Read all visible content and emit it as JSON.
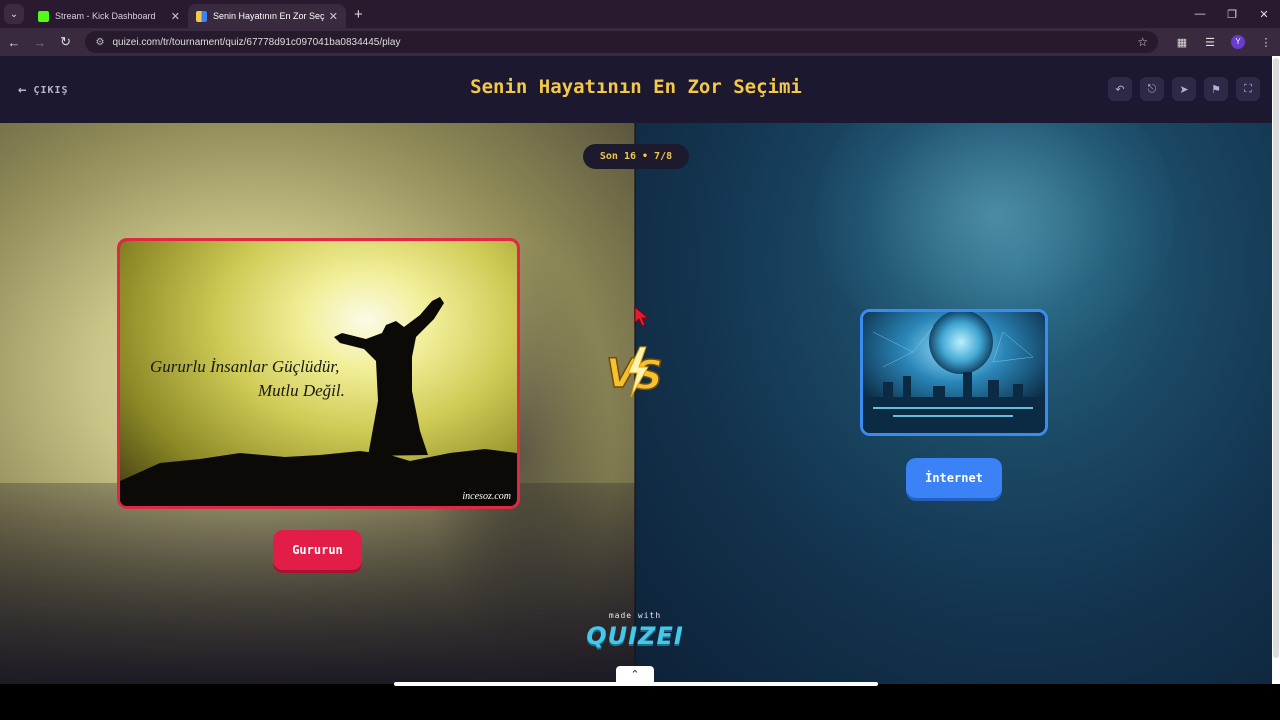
{
  "browser": {
    "tabs": [
      {
        "title": "Stream - Kick Dashboard",
        "favicon_color": "#53fc18",
        "active": false
      },
      {
        "title": "Senin Hayatının En Zor Seçimi",
        "favicon_color": "#f4c84a",
        "active": true
      }
    ],
    "url": "quizei.com/tr/tournament/quiz/67778d91c097041ba0834445/play",
    "profile_initial": "Y"
  },
  "page": {
    "exit_label": "ÇIKIŞ",
    "title": "Senin Hayatının En Zor Seçimi",
    "toolbar_icons": [
      "undo-icon",
      "share-icon",
      "send-icon",
      "flag-icon",
      "fullscreen-icon"
    ],
    "round_label": "Son 16 • 7/8",
    "left_choice": {
      "label": "Gururun",
      "image_text_line1": "Gururlu İnsanlar Güçlüdür,",
      "image_text_line2": "Mutlu Değil.",
      "watermark": "incesoz.com",
      "color": "#e11d48"
    },
    "right_choice": {
      "label": "İnternet",
      "color": "#3b82f6"
    },
    "vs_label": "VS",
    "made_with": "made with",
    "brand": "QUIZEI"
  },
  "colors": {
    "accent_title": "#f4c84a",
    "left_border": "#e02844",
    "right_border": "#3b8cf0",
    "brand": "#45c8ea"
  }
}
